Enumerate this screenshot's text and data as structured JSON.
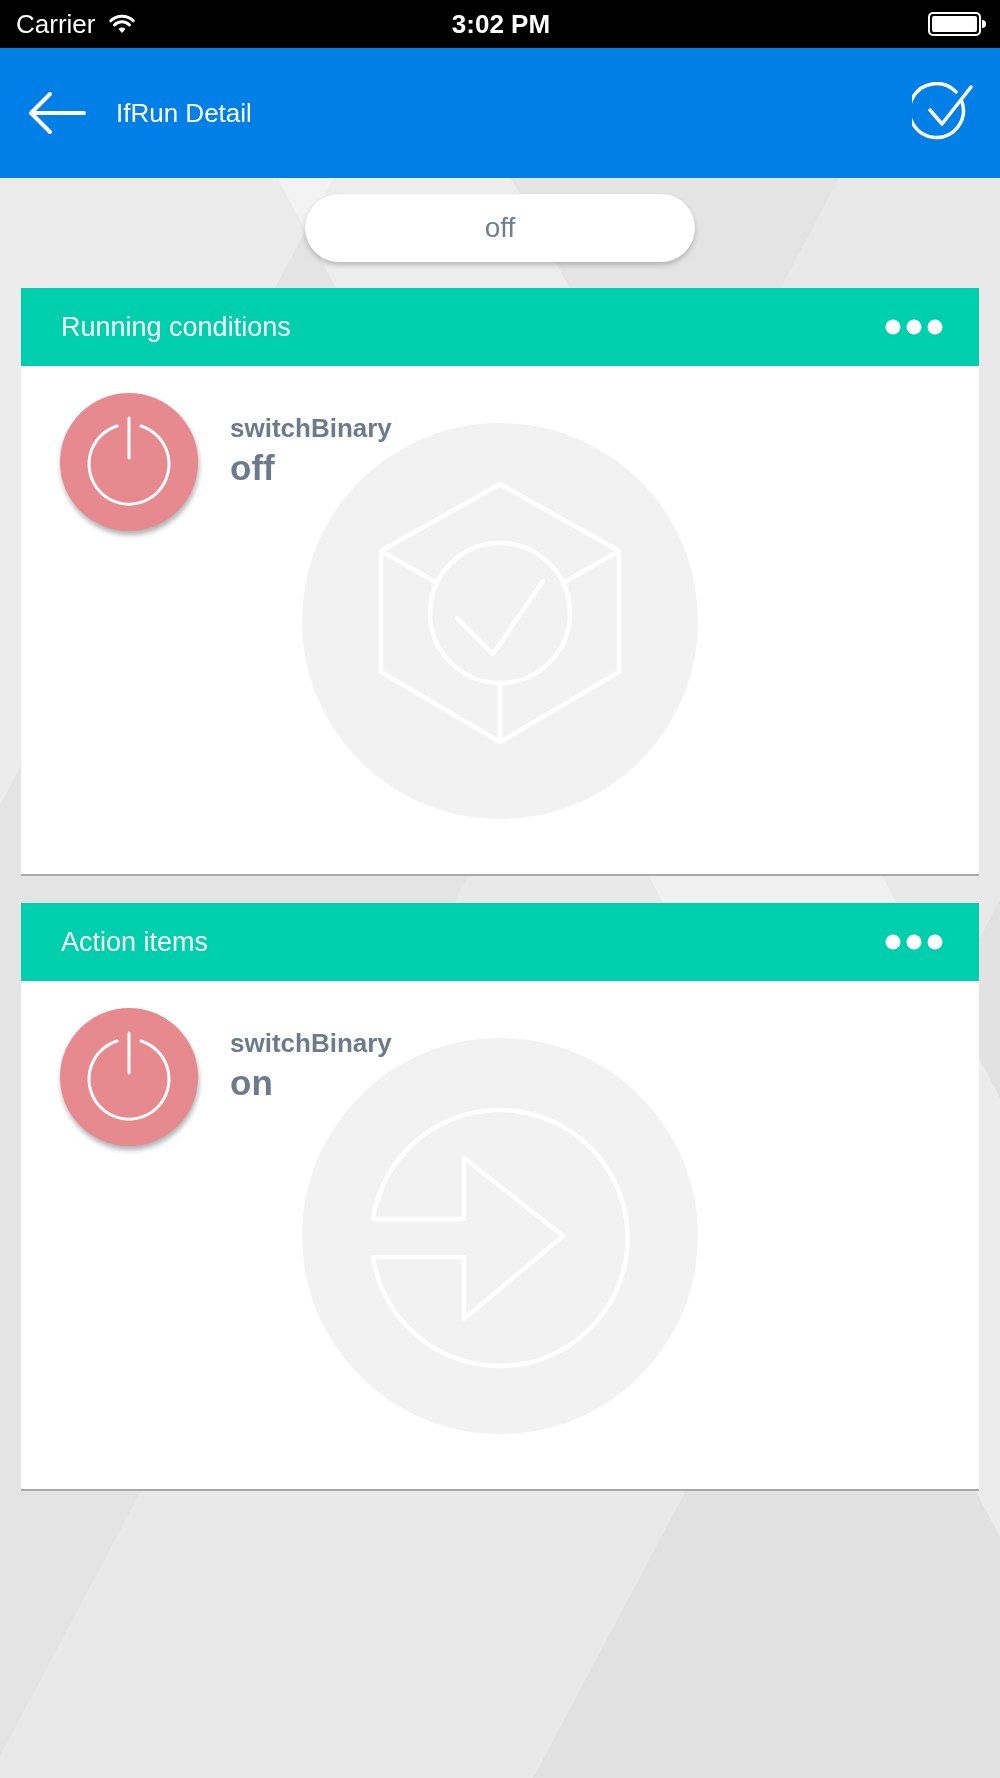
{
  "status_bar": {
    "carrier": "Carrier",
    "time": "3:02 PM"
  },
  "header": {
    "title": "IfRun Detail"
  },
  "state_pill": {
    "label": "off"
  },
  "cards": [
    {
      "kind": "condition",
      "title": "Running conditions",
      "device": {
        "name": "switchBinary",
        "value": "off"
      }
    },
    {
      "kind": "action",
      "title": "Action items",
      "device": {
        "name": "switchBinary",
        "value": "on"
      }
    }
  ]
}
